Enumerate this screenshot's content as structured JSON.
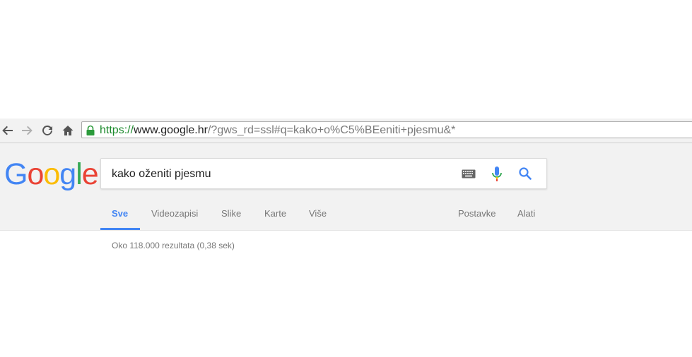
{
  "browser": {
    "url_scheme": "https://",
    "url_host": "www.google.hr",
    "url_rest": "/?gws_rd=ssl#q=kako+o%C5%BEeniti+pjesmu&*"
  },
  "google": {
    "logo_letters": [
      "G",
      "o",
      "o",
      "g",
      "l",
      "e"
    ],
    "search_value": "kako oženiti pjesmu",
    "tabs": [
      {
        "label": "Sve",
        "active": true
      },
      {
        "label": "Videozapisi"
      },
      {
        "label": "Slike"
      },
      {
        "label": "Karte"
      },
      {
        "label": "Više"
      }
    ],
    "right_tabs": [
      {
        "label": "Postavke"
      },
      {
        "label": "Alati"
      }
    ],
    "result_stats": "Oko 118.000 rezultata (0,38 sek)"
  },
  "colors": {
    "accent_blue": "#4285f4",
    "red": "#ea4335",
    "yellow": "#fbbc05",
    "green": "#34a853",
    "secure_green": "#1e8b2e"
  },
  "icons": [
    "back-icon",
    "forward-icon",
    "reload-icon",
    "home-icon",
    "lock-icon",
    "keyboard-icon",
    "microphone-icon",
    "search-icon"
  ]
}
